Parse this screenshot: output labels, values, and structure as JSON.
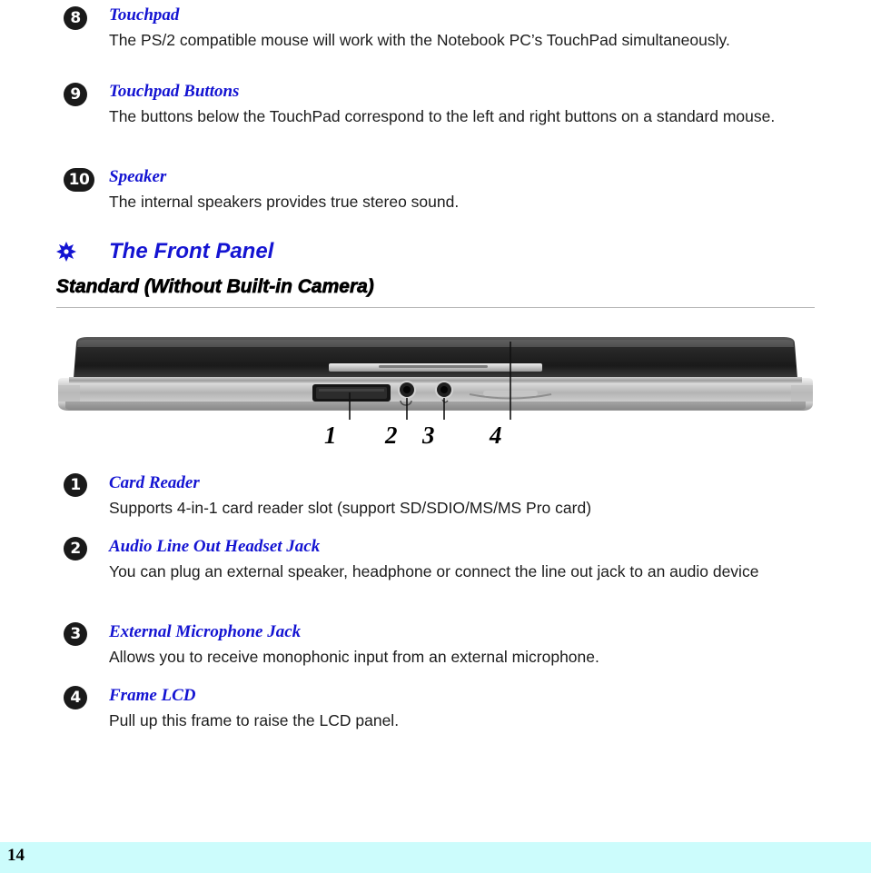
{
  "document": {
    "page_number": "14",
    "items_top": [
      {
        "num": "8",
        "title": "Touchpad",
        "text": "The PS/2 compatible mouse will work with the Notebook PC’s TouchPad simultaneously."
      },
      {
        "num": "9",
        "title": "Touchpad Buttons",
        "text": "The buttons below the TouchPad correspond to the left and right buttons on a standard mouse."
      },
      {
        "num": "10",
        "title": "Speaker",
        "text": "The internal speakers provides true stereo sound."
      }
    ],
    "section": {
      "icon": "decorative-flower-icon",
      "title": "The Front Panel",
      "subtitle": "Standard (Without Built-in Camera)"
    },
    "figure": {
      "alt": "front panel of notebook computer",
      "callouts": [
        "1",
        "2",
        "3",
        "4"
      ]
    },
    "items_bottom": [
      {
        "num": "1",
        "title": "Card Reader",
        "text": "Supports 4-in-1 card reader slot (support SD/SDIO/MS/MS Pro card)"
      },
      {
        "num": "2",
        "title": "Audio Line Out Headset Jack",
        "text": "You can plug an external speaker, headphone or connect the line out jack to an audio device"
      },
      {
        "num": "3",
        "title": "External Microphone Jack",
        "text": "Allows you to receive monophonic input from an external microphone."
      },
      {
        "num": "4",
        "title": "Frame LCD",
        "text": "Pull up this frame to raise the LCD panel."
      }
    ],
    "colors": {
      "heading": "#1414d2",
      "footer_band": "#ccfcfc",
      "badge": "#1a1a1a"
    }
  }
}
